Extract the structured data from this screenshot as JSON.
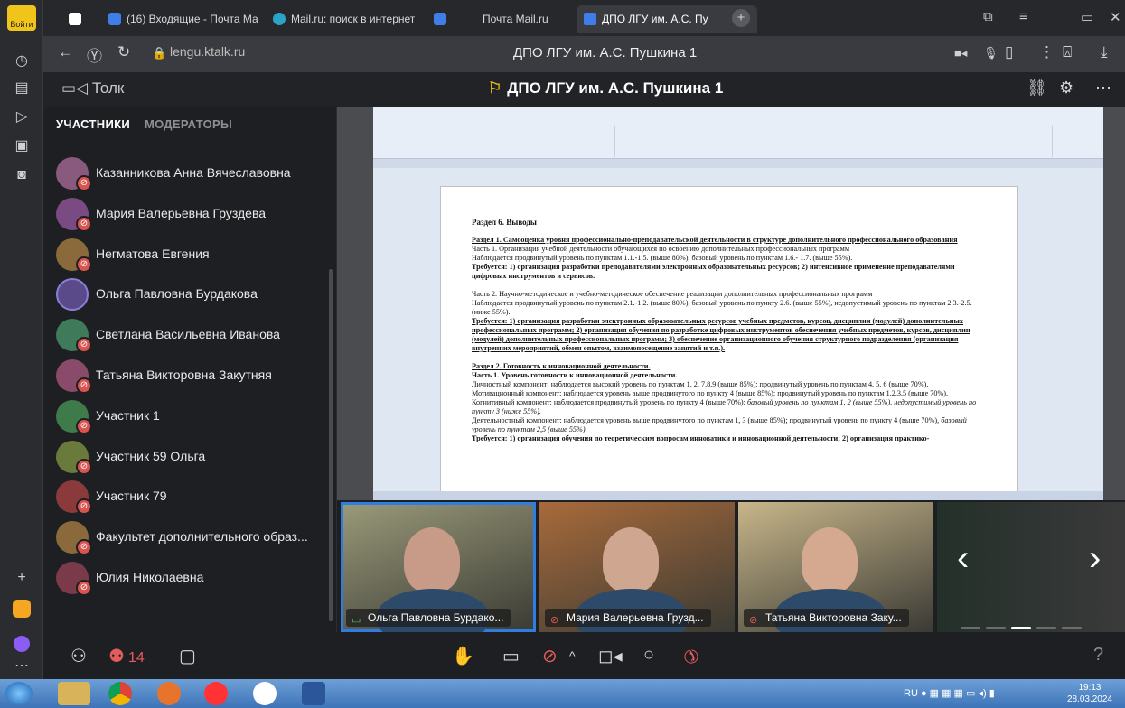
{
  "browser": {
    "login_label": "Войти",
    "tabs": [
      {
        "label": "(16) Входящие - Почта Ма",
        "active": false
      },
      {
        "label": "Mail.ru: поиск в интернет",
        "active": false
      },
      {
        "label": "",
        "active": false
      },
      {
        "label": "Почта Mail.ru",
        "active": false
      },
      {
        "label": "ДПО ЛГУ им. А.С. Пу",
        "active": true
      }
    ],
    "url": "lengu.ktalk.ru",
    "page_title": "ДПО ЛГУ им. А.С. Пушкина 1"
  },
  "app": {
    "logo": "Толк",
    "room_title": "ДПО ЛГУ им. А.С. Пушкина 1"
  },
  "participants_panel": {
    "tab_participants": "УЧАСТНИКИ",
    "tab_moderators": "МОДЕРАТОРЫ",
    "items": [
      {
        "name": "Казанникова Анна Вячеславовна",
        "color": "#8a5a7e"
      },
      {
        "name": "Мария Валерьевна Груздева",
        "color": "#7a4a82"
      },
      {
        "name": "Негматова Евгения",
        "color": "#8a6a3a"
      },
      {
        "name": "Ольга Павловна Бурдакова",
        "color": "#5a4a8a"
      },
      {
        "name": "Светлана Васильевна Иванова",
        "color": "#3f7a5a"
      },
      {
        "name": "Татьяна Викторовна Закутняя",
        "color": "#8a4a6a"
      },
      {
        "name": "Участник 1",
        "color": "#3f7a4a"
      },
      {
        "name": "Участник 59 Ольга",
        "color": "#6a7a3a"
      },
      {
        "name": "Участник 79",
        "color": "#8a3a3a"
      },
      {
        "name": "Факультет дополнительного образ...",
        "color": "#8a6a3a"
      },
      {
        "name": "Юлия Николаевна",
        "color": "#7a3a4a"
      }
    ]
  },
  "document": {
    "heading": "Раздел 6. Выводы",
    "s1_title": "Раздел 1. Самооценка уровня профессионально-преподавательской деятельности в структуре дополнительного профессионального образования",
    "s1_p1": "Часть 1. Организация учебной деятельности обучающихся по освоению дополнительных профессиональных программ",
    "s1_p2": "Наблюдается продвинутый уровень по пунктам 1.1.-1.5. (выше 80%), базовый уровень по пунктам 1.6.- 1.7. (выше 55%).",
    "s1_p3": "Требуется: 1) организация разработки преподавателями электронных образовательных ресурсов; 2) интенсивное применение преподавателями цифровых инструментов и сервисов.",
    "s1_p4": "Часть 2. Научно-методическое и учебно-методическое обеспечение реализации дополнительных профессиональных программ",
    "s1_p5": "Наблюдается продвинутый уровень по пунктам 2.1.-1.2. (выше 80%), базовый уровень по пункту 2.6. (выше 55%), недопустимый уровень по пунктам 2.3.-2.5. (ниже 55%).",
    "s1_p6": "Требуется: 1) организация разработки электронных образовательных ресурсов учебных предметов, курсов, дисциплин (модулей) дополнительных профессиональных программ; 2) организация обучения по разработке цифровых инструментов обеспечения учебных предметов, курсов, дисциплин (модулей) дополнительных профессиональных программ; 3) обеспечение организационного обучения структурного подразделения (организация внутренних мероприятий, обмен опытом, взаимопосещение занятий и т.п.).",
    "s2_title": "Раздел 2. Готовность к инновационной деятельности.",
    "s2_sub": "Часть 1. Уровень готовности к инновационной деятельности.",
    "s2_p1": "Личностный компонент: наблюдается высокий уровень по пунктам 1, 2, 7,8,9 (выше 85%); продвинутый уровень по пунктам 4, 5, 6 (выше 70%).",
    "s2_p2": "Мотивационный компонент: наблюдается уровень выше продвинутого по пункту 4 (выше 85%); продвинутый уровень по пунктам 1,2,3,5 (выше 70%).",
    "s2_p3a": "Когнитивный компонент: наблюдается продвинутый уровень по пункту 4 (выше 70%); ",
    "s2_p3b": "базовый уровень по пунктам 1, 2 (выше 55%), недопустимый уровень по пункту 3 (ниже 55%).",
    "s2_p4a": "Деятельностный компонент: наблюдается уровень выше продвинутого по пунктам 1, 3 (выше 85%); продвинутый уровень по пункту 4 (выше 70%), ",
    "s2_p4b": "базовый уровень по пунктам 2,5 (выше 55%).",
    "s2_p5": "Требуется: 1) организация обучения по теоретическим вопросам инноватики и инновационной деятельности; 2) организация практико-"
  },
  "videos": [
    {
      "name": "Ольга Павловна Бурдако...",
      "selected": true,
      "muted": false,
      "bg": "#9a9a7a",
      "skin": "#c89a88"
    },
    {
      "name": "Мария Валерьевна Грузд...",
      "selected": false,
      "muted": true,
      "bg": "#a86a3a",
      "skin": "#cfa690"
    },
    {
      "name": "Татьяна Викторовна Заку...",
      "selected": false,
      "muted": true,
      "bg": "#c8b68a",
      "skin": "#d4a990"
    }
  ],
  "controls": {
    "participant_count": "14"
  },
  "taskbar": {
    "lang": "RU",
    "time": "19:13",
    "date": "28.03.2024"
  },
  "icons": [
    "clock-icon",
    "notes-icon",
    "play-icon",
    "badge-icon",
    "screenshot-icon",
    "back-icon",
    "yandex-icon",
    "refresh-icon",
    "lock-icon",
    "camera-icon",
    "mic-icon",
    "bookmark-icon",
    "menu-icon",
    "download-icon",
    "link-icon",
    "settings-icon",
    "more-icon",
    "hand-icon",
    "screen-share-icon",
    "mic-off-icon",
    "video-icon",
    "record-icon",
    "hangup-icon",
    "chat-icon",
    "help-icon"
  ]
}
